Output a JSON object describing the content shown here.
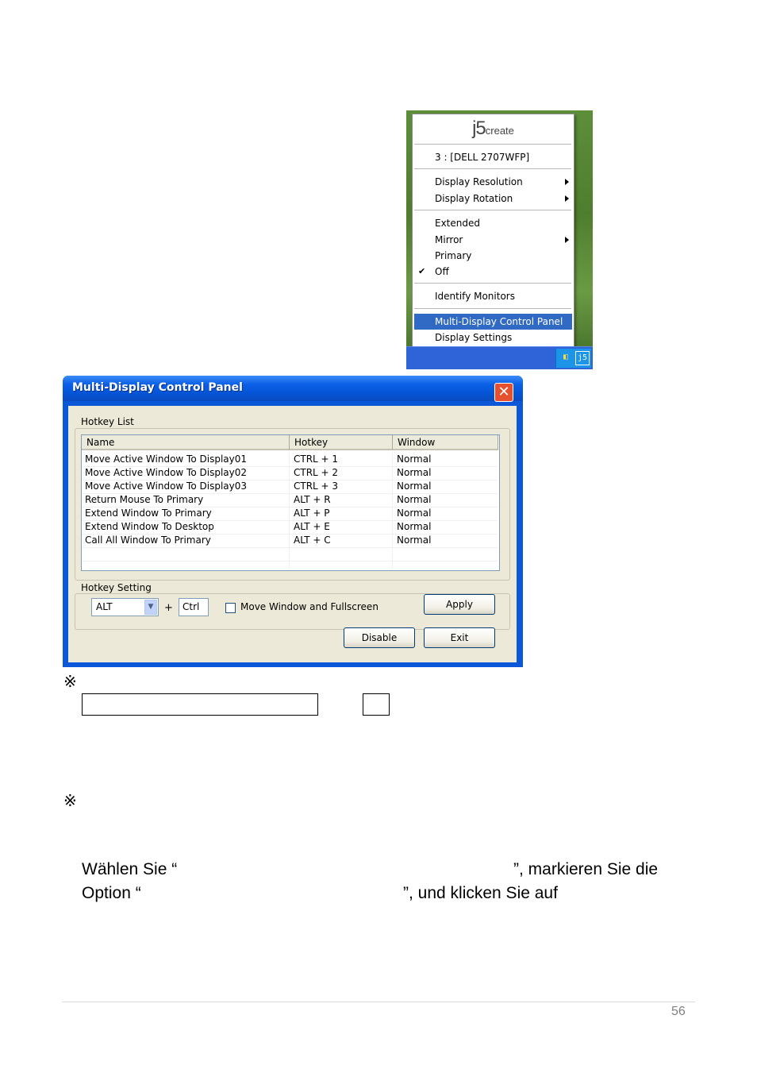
{
  "tray_menu": {
    "logo_j5": "j5",
    "logo_create": "create",
    "monitor_label": "3 : [DELL 2707WFP]",
    "items": [
      {
        "label": "Display Resolution",
        "submenu": true
      },
      {
        "label": "Display Rotation",
        "submenu": true
      },
      {
        "label": "Extended",
        "submenu": false
      },
      {
        "label": "Mirror",
        "submenu": true
      },
      {
        "label": "Primary",
        "submenu": false
      },
      {
        "label": "Off",
        "submenu": false,
        "checked": true
      },
      {
        "label": "Identify Monitors",
        "submenu": false
      },
      {
        "label": "Multi-Display Control Panel",
        "submenu": false,
        "highlighted": true
      },
      {
        "label": "Display Settings",
        "submenu": false
      }
    ],
    "tray_icon_label": "j5"
  },
  "dialog": {
    "title": "Multi-Display Control Panel",
    "hotkey_list_label": "Hotkey List",
    "columns": [
      "Name",
      "Hotkey",
      "Window"
    ],
    "rows": [
      [
        "Move Active Window To Display01",
        "CTRL + 1",
        "Normal"
      ],
      [
        "Move Active Window To Display02",
        "CTRL + 2",
        "Normal"
      ],
      [
        "Move Active Window To Display03",
        "CTRL + 3",
        "Normal"
      ],
      [
        "Return Mouse To Primary",
        "ALT + R",
        "Normal"
      ],
      [
        "Extend Window To Primary",
        "ALT + P",
        "Normal"
      ],
      [
        "Extend Window To Desktop",
        "ALT + E",
        "Normal"
      ],
      [
        "Call All Window To Primary",
        "ALT + C",
        "Normal"
      ]
    ],
    "hotkey_setting_label": "Hotkey Setting",
    "modifier_value": "ALT",
    "plus_sign": "+",
    "key_value": "Ctrl",
    "checkbox_label": "Move Window and Fullscreen",
    "apply_label": "Apply",
    "disable_label": "Disable",
    "exit_label": "Exit"
  },
  "page": {
    "ref_mark_1": "※",
    "ref_mark_2": "※",
    "line1_a": "Wählen Sie “",
    "line1_b": "”, markieren Sie die",
    "line2_a": "Option “",
    "line2_b": "”, und klicken Sie auf",
    "page_number": "56"
  }
}
